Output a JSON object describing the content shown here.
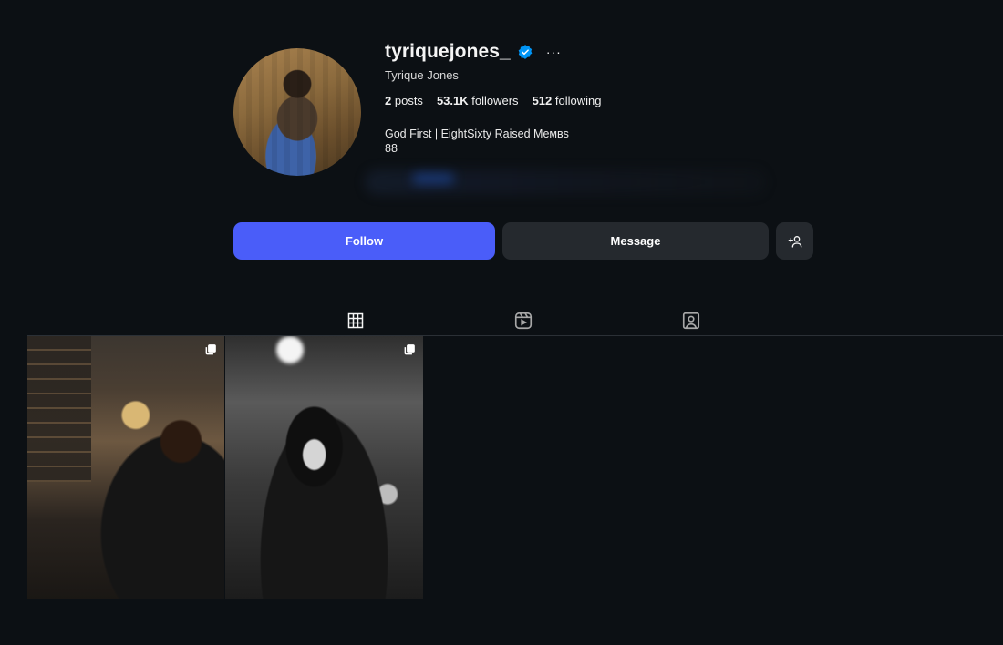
{
  "profile": {
    "username": "tyriquejones_",
    "full_name": "Tyrique Jones",
    "verified": true,
    "more_label": "···",
    "stats": {
      "posts_count": "2",
      "posts_label": "posts",
      "followers_count": "53.1K",
      "followers_label": "followers",
      "following_count": "512",
      "following_label": "following"
    },
    "bio_line1": "God First | EightSixty Raised Meмвs",
    "bio_line2": "88"
  },
  "actions": {
    "follow_label": "Follow",
    "message_label": "Message",
    "suggest_label": "+👤"
  },
  "tabs": [
    {
      "name": "posts",
      "icon": "grid-icon",
      "active": true
    },
    {
      "name": "reels",
      "icon": "reels-icon",
      "active": false
    },
    {
      "name": "tagged",
      "icon": "tagged-icon",
      "active": false
    }
  ],
  "posts": [
    {
      "type": "carousel",
      "icon": "multi-image-icon"
    },
    {
      "type": "carousel",
      "icon": "multi-image-icon"
    }
  ],
  "colors": {
    "background": "#0c1014",
    "follow_button": "#4a5df9",
    "secondary_button": "#25292e",
    "verified_badge": "#0095f6"
  }
}
